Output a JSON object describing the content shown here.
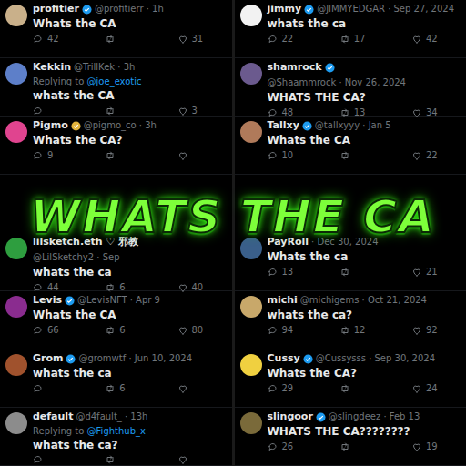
{
  "banner": {
    "text": "WHATS THE CA"
  },
  "columns": [
    {
      "tweets": [
        {
          "name": "profitier",
          "badge_color": "#1d9bf0",
          "avatar_color": "#c9b08a",
          "meta": "@profitierr · 1h",
          "text": "Whats the CA",
          "replies": "42",
          "retweets": "",
          "likes": "31"
        },
        {
          "name": "Kekkin",
          "badge_color": "",
          "avatar_color": "#5d7fc9",
          "meta": "@TrillKek · 3h",
          "reply_label": "Replying to",
          "reply_to": "@joe_exotic",
          "text": "whats the CA",
          "replies": "",
          "retweets": "",
          "likes": "3"
        },
        {
          "name": "Pigmo",
          "badge_color": "#e2b33c",
          "avatar_color": "#e0448f",
          "meta": "@pigmo_co · 3h",
          "text": "Whats the CA?",
          "replies": "9",
          "retweets": "",
          "likes": ""
        },
        {
          "name": "lilsketch.eth ♡ 邪教",
          "badge_color": "",
          "avatar_color": "#2e9e3f",
          "meta": "@LilSketchy2 · Sep",
          "text": "whats the ca",
          "replies": "44",
          "retweets": "6",
          "likes": "40"
        },
        {
          "name": "Levis",
          "badge_color": "#1d9bf0",
          "avatar_color": "#8a2c8f",
          "meta": "@LevisNFT · Apr 9",
          "text": "Whats the CA",
          "replies": "66",
          "retweets": "6",
          "likes": "80"
        },
        {
          "name": "Grom",
          "badge_color": "#1d9bf0",
          "avatar_color": "#a0522d",
          "meta": "@gromwtf · Jun 10, 2024",
          "text": "whats the ca",
          "replies": "",
          "retweets": "6",
          "likes": ""
        },
        {
          "name": "default",
          "badge_color": "",
          "avatar_color": "#8c8c8c",
          "meta": "@d4fault_ · 13h",
          "reply_label": "Replying to",
          "reply_to": "@Fighthub_x",
          "text": "whats the ca?",
          "replies": "",
          "retweets": "",
          "likes": ""
        }
      ]
    },
    {
      "tweets": [
        {
          "name": "jimmy",
          "badge_color": "#1d9bf0",
          "avatar_color": "#f2f2f2",
          "meta": "@JIMMYEDGAR · Sep 27, 2024",
          "text": "whats the ca",
          "replies": "22",
          "retweets": "17",
          "likes": "42"
        },
        {
          "name": "shamrock",
          "badge_color": "#1d9bf0",
          "avatar_color": "#6b5a8e",
          "meta": "@Shaammrock · Nov 26, 2024",
          "text": "WHATS THE CA?",
          "replies": "48",
          "retweets": "13",
          "likes": "34"
        },
        {
          "name": "Tallxy",
          "badge_color": "#1d9bf0",
          "avatar_color": "#b07a5a",
          "meta": "@tallxyyy · Jan 5",
          "text": "Whats the CA",
          "replies": "10",
          "retweets": "",
          "likes": "22"
        },
        {
          "name": "PayRoll",
          "badge_color": "",
          "avatar_color": "#3a5f8a",
          "meta": "· Dec 30, 2024",
          "text": "Whats the ca",
          "replies": "13",
          "retweets": "",
          "likes": "21"
        },
        {
          "name": "michi",
          "badge_color": "",
          "avatar_color": "#c8a86a",
          "meta": "@michigems · Oct 21, 2024",
          "text": "whats the ca?",
          "replies": "94",
          "retweets": "12",
          "likes": "92"
        },
        {
          "name": "Cussy",
          "badge_color": "#1d9bf0",
          "avatar_color": "#f0d040",
          "meta": "@Cussysss · Sep 30, 2024",
          "text": "Whats the CA?",
          "replies": "29",
          "retweets": "",
          "likes": "24"
        },
        {
          "name": "slingoor",
          "badge_color": "#1d9bf0",
          "avatar_color": "#7a6a3a",
          "meta": "@slingdeez · Feb 13",
          "text": "WHATS THE CA????????",
          "replies": "26",
          "retweets": "",
          "likes": "19"
        }
      ]
    }
  ]
}
